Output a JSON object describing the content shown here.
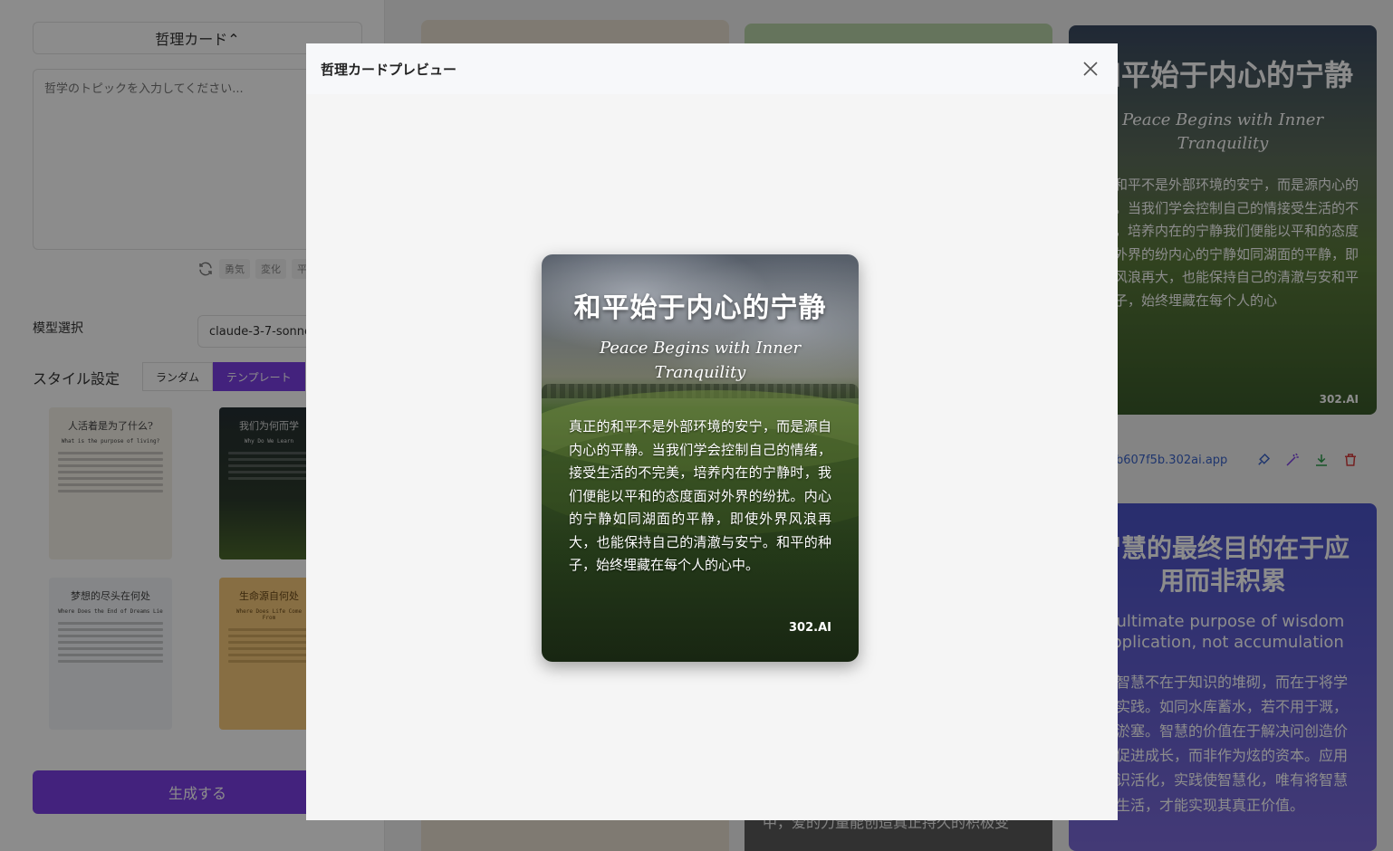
{
  "app": {
    "card_type_select": "哲理カード⌃",
    "topic_placeholder": "哲学のトピックを入力してください...",
    "tags": [
      "勇気",
      "変化",
      "平"
    ],
    "model_label": "模型選択",
    "model_value": "claude-3-7-sonne",
    "style_label": "スタイル設定",
    "style_tabs": [
      "ランダム",
      "テンプレート"
    ],
    "generate_label": "生成する"
  },
  "templates": [
    {
      "title": "人活着是为了什么?",
      "subtitle": "What is the purpose of living?"
    },
    {
      "title": "我们为何而学",
      "subtitle": "Why Do We Learn"
    },
    {
      "title": "梦想的尽头在何处",
      "subtitle": "Where Does the End of Dreams Lie"
    },
    {
      "title": "生命源自何处",
      "subtitle": "Where Does Life Come From"
    }
  ],
  "grid": {
    "card3": {
      "title": "和平始于内心的宁静",
      "subtitle": "Peace Begins with Inner Tranquility",
      "body": "正的和平不是外部环境的安宁，而是源内心的平静。当我们学会控制自己的情接受生活的不完美，培养内在的宁静我们便能以平和的态度面对外界的纷内心的宁静如同湖面的平静，即使外风浪再大，也能保持自己的清澈与安和平的种子，始终埋藏在每个人的心",
      "brand": "302.AI",
      "url": "b607f5b.302ai.app"
    },
    "card4": {
      "title": "智慧的最终目的在于应用而非积累",
      "subtitle": "e ultimate purpose of wisdom application, not accumulation",
      "body": "正的智慧不在于知识的堆砌，而在于将学付诸实践。如同水库蓄水，若不用于溉，终将淤塞。智慧的价值在于解决问创造价值和促进成长，而非作为炫的资本。应用使知识活化，实践使智慧化，唯有将智慧融入生活，才能实现其真正价值。"
    },
    "card2_bottom": "中，爱的力量能创造真正持久的积极变"
  },
  "modal": {
    "title": "哲理カードプレビュー",
    "card": {
      "title": "和平始于内心的宁静",
      "subtitle": "Peace Begins with Inner Tranquility",
      "body": "真正的和平不是外部环境的安宁，而是源自内心的平静。当我们学会控制自己的情绪，接受生活的不完美，培养内在的宁静时，我们便能以平和的态度面对外界的纷扰。内心的宁静如同湖面的平静，即使外界风浪再大，也能保持自己的清澈与安宁。和平的种子，始终埋藏在每个人的心中。",
      "brand": "302.AI"
    }
  }
}
